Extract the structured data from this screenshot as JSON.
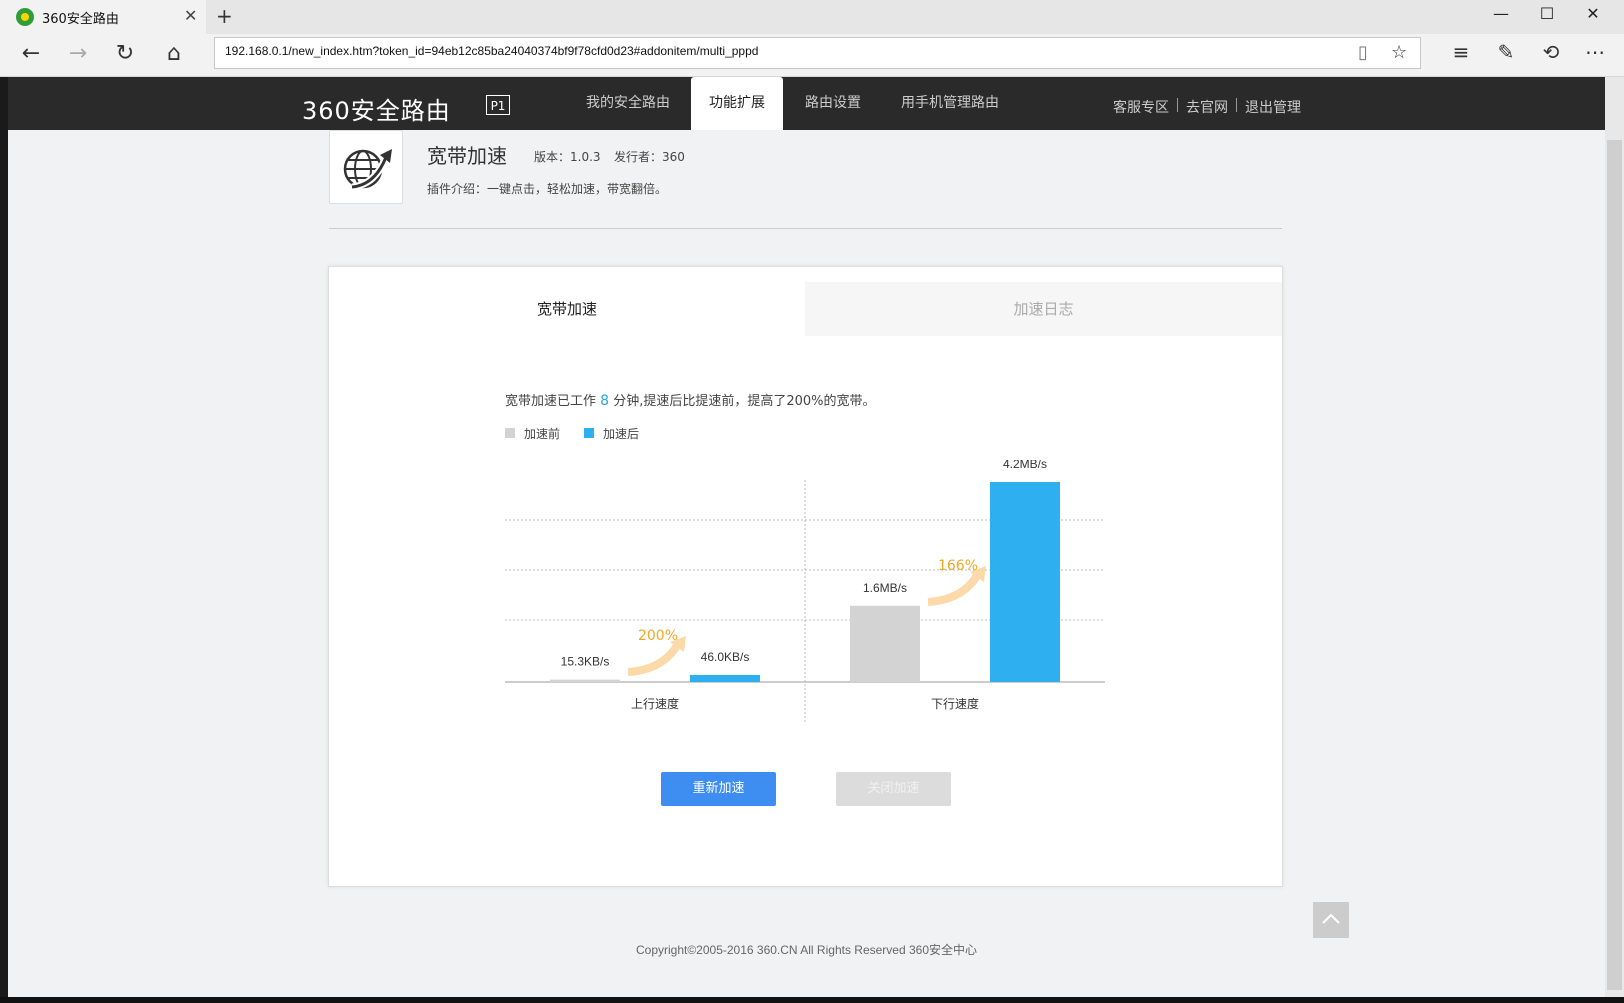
{
  "browser": {
    "tab_title": "360安全路由",
    "new_tab": "+",
    "tab_close": "✕",
    "address": "192.168.0.1/new_index.htm?token_id=94eb12c85ba24040374bf9f78cfd0d23#addonitem/multi_pppd",
    "window_buttons": [
      "—",
      "☐",
      "✕"
    ]
  },
  "header": {
    "logo": "360安全路由",
    "logo_badge": "P1",
    "nav": [
      "我的安全路由",
      "功能扩展",
      "路由设置",
      "用手机管理路由"
    ],
    "active_nav": "功能扩展",
    "links": [
      "客服专区",
      "去官网",
      "退出管理"
    ]
  },
  "plugin": {
    "title": "宽带加速",
    "version": "版本：1.0.3",
    "publisher": "发行者：360",
    "description": "插件介绍：一键点击，轻松加速，带宽翻倍。"
  },
  "tabs": [
    "宽带加速",
    "加速日志"
  ],
  "summary": {
    "prefix": "宽带加速已工作",
    "minutes": "8",
    "suffix": "分钟,提速后比提速前，提高了200%的宽带。"
  },
  "legend": [
    {
      "label": "加速前",
      "color": "#d3d3d3"
    },
    {
      "label": "加速后",
      "color": "#2eb0f0"
    }
  ],
  "chart_data": {
    "type": "bar",
    "categories": [
      "上行速度",
      "下行速度"
    ],
    "series": [
      {
        "name": "加速前",
        "values": [
          15.3,
          1600
        ],
        "labels": [
          "15.3KB/s",
          "1.6MB/s"
        ],
        "color": "#d3d3d3"
      },
      {
        "name": "加速后",
        "values": [
          46.0,
          4200
        ],
        "labels": [
          "46.0KB/s",
          "4.2MB/s"
        ],
        "color": "#2eb0f0"
      }
    ],
    "annotations": [
      "200%",
      "166%"
    ],
    "unit": "KB/s"
  },
  "buttons": {
    "restart": "重新加速",
    "close": "关闭加速"
  },
  "footer": "Copyright©2005-2016 360.CN All Rights Reserved 360安全中心"
}
